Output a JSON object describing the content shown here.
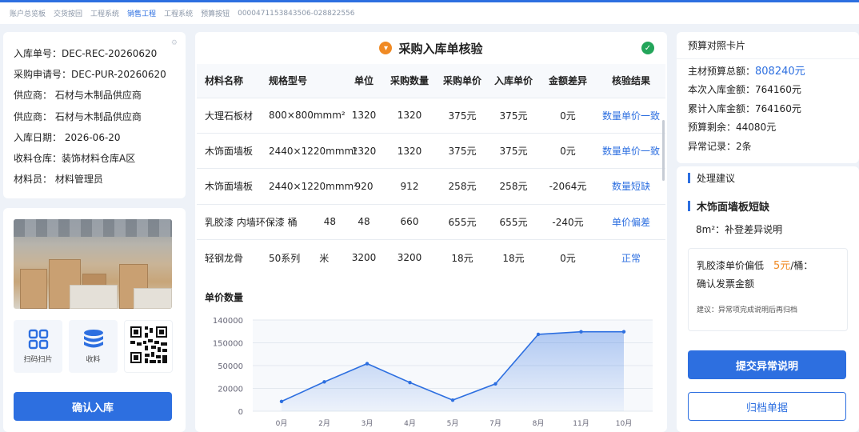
{
  "topbar": {
    "items": [
      "账户总览板",
      "交货按回",
      "工程系统",
      "销售工程",
      "工程系统",
      "预算按钮",
      "0000471153843506-028822556"
    ],
    "active_index": 3
  },
  "info": {
    "rows": [
      "入库单号：DEC-REC-20260620",
      "采购申请号：DEC-PUR-20260620",
      "供应商： 石材与木制品供应商",
      "供应商： 石材与木制品供应商",
      "入库日期： 2026-06-20",
      "收料仓库：装饰材料仓库A区",
      "材料员： 材料管理员"
    ]
  },
  "side": {
    "tiles": [
      {
        "label": "扫码扫片",
        "icon": "grid-icon"
      },
      {
        "label": "收料",
        "icon": "database-icon"
      },
      {
        "label": "",
        "icon": "qr-code-icon"
      }
    ],
    "confirm_label": "确认入库"
  },
  "center": {
    "title": "采购入库单核验",
    "columns": [
      "材料名称",
      "规格型号",
      "单位",
      "采购数量",
      "采购单价",
      "入库单价",
      "金额差异",
      "核验结果"
    ],
    "rows": [
      [
        "大理石板材",
        "800×800mmm²",
        "1320",
        "1320",
        "375元",
        "375元",
        "0元",
        "数量单价一致"
      ],
      [
        "木饰面墙板",
        "2440×1220mmm²",
        "1320",
        "1320",
        "375元",
        "375元",
        "0元",
        "数量单价一致"
      ],
      [
        "木饰面墙板",
        "2440×1220mmm²",
        "920",
        "912",
        "258元",
        "258元",
        "-2064元",
        "数量短缺"
      ],
      [
        "乳胶漆 内墙环保漆 桶",
        "48",
        "48",
        "660",
        "655元",
        "655元",
        "-240元",
        "单价偏差"
      ],
      [
        "轻钢龙骨",
        "50系列　　米",
        "3200",
        "3200",
        "18元",
        "18元",
        "0元",
        "正常"
      ]
    ]
  },
  "chart_data": {
    "type": "area",
    "title": "单价数量",
    "categories": [
      "0月",
      "2月",
      "3月",
      "4月",
      "5月",
      "7月",
      "8月",
      "11月",
      "10月"
    ],
    "values": [
      15000,
      45000,
      73000,
      44000,
      17000,
      42000,
      118000,
      122000,
      122000
    ],
    "ylim": [
      0,
      140000
    ],
    "yticks": [
      "0",
      "20000",
      "50000",
      "150000",
      "140000"
    ],
    "ytick_values": [
      0,
      35000,
      70000,
      105000,
      140000
    ],
    "color": "#2d6fe0"
  },
  "budget": {
    "title": "预算对照卡片",
    "rows": [
      {
        "label": "主材预算总额：",
        "value": "808240元"
      },
      {
        "label": "本次入库金额：",
        "value": "764160元"
      },
      {
        "label": "累计入库金额：",
        "value": "764160元"
      },
      {
        "label": "预算剩余：",
        "value": "44080元"
      },
      {
        "label": "异常记录：",
        "value": "2条"
      }
    ]
  },
  "advice": {
    "title": "处理建议",
    "headline": "木饰面墙板短缺",
    "line": "8m²：补登差异说明",
    "note_a": "乳胶漆单价偏低",
    "note_b": "5元",
    "note_c": "/桶：",
    "note_d": "确认发票金额",
    "suggestion": "建议：异常项完成说明后再归档",
    "submit_label": "提交异常说明",
    "archive_label": "归档单据"
  }
}
